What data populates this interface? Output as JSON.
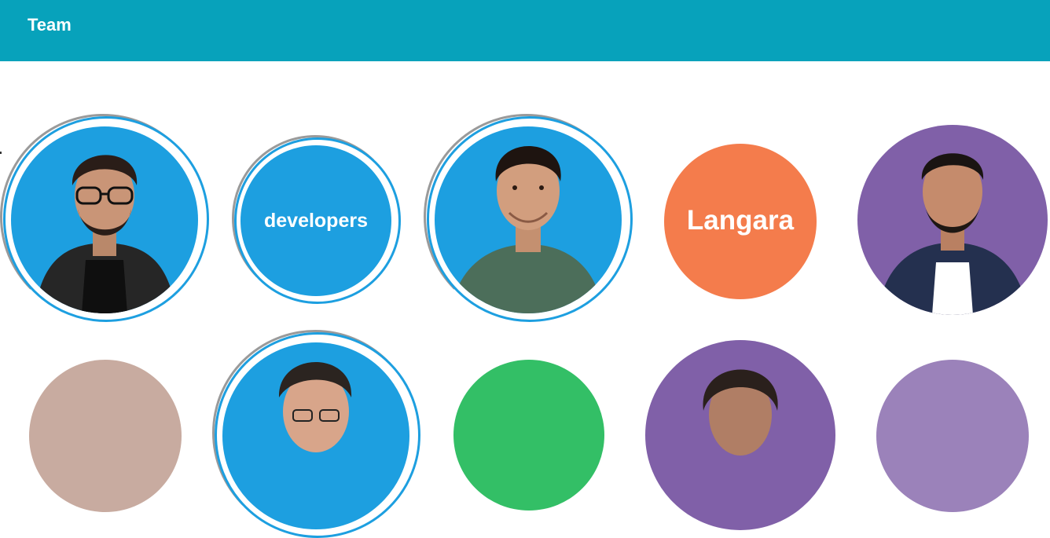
{
  "header": {
    "title": "Team",
    "background": "#07a2bb"
  },
  "team": {
    "row1": [
      {
        "kind": "photo",
        "name": "member-1",
        "bg": "#1d9fe0",
        "icon": "person-photo"
      },
      {
        "kind": "text",
        "label": "developers",
        "bg": "#1d9fe0"
      },
      {
        "kind": "photo",
        "name": "member-2",
        "bg": "#1d9fe0",
        "icon": "person-photo"
      },
      {
        "kind": "text",
        "label": "Langara",
        "bg": "#f47c4c"
      },
      {
        "kind": "photo",
        "name": "member-3",
        "bg": "#8060a8",
        "icon": "person-photo"
      }
    ],
    "row2": [
      {
        "kind": "plain",
        "bg": "#c8aba0"
      },
      {
        "kind": "photo",
        "name": "member-4",
        "bg": "#1d9fe0",
        "icon": "person-photo"
      },
      {
        "kind": "plain",
        "bg": "#33bf66"
      },
      {
        "kind": "photo",
        "name": "member-5",
        "bg": "#8060a8",
        "icon": "person-photo"
      },
      {
        "kind": "plain",
        "bg": "#9b82ba"
      }
    ]
  }
}
